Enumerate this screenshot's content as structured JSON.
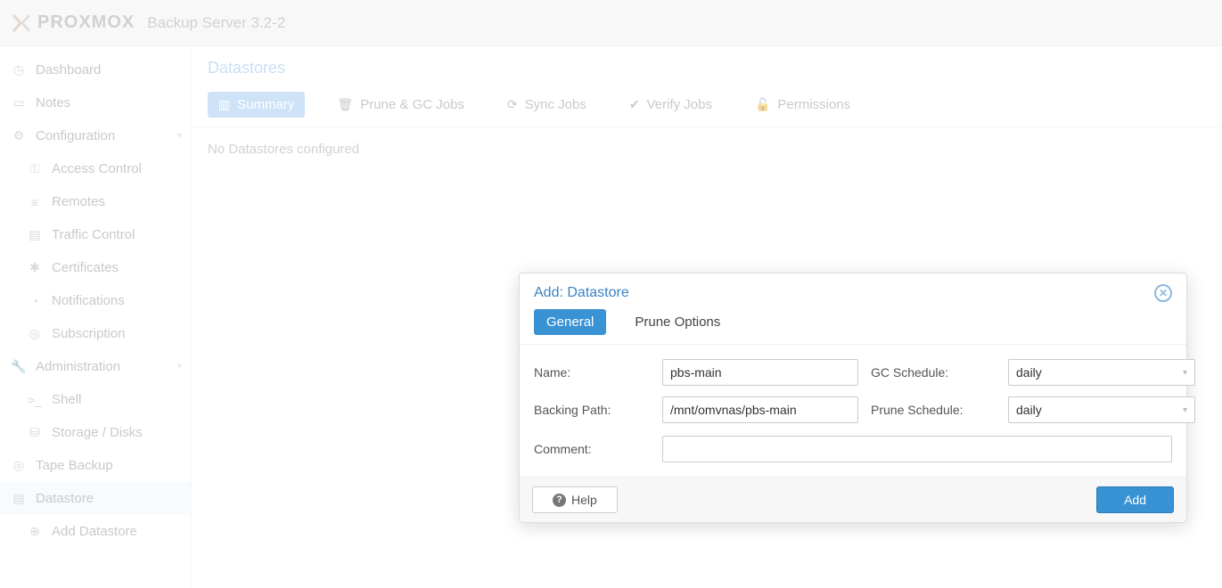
{
  "header": {
    "brand": "PROXMOX",
    "subtitle": "Backup Server 3.2-2"
  },
  "sidebar": {
    "items": [
      {
        "label": "Dashboard"
      },
      {
        "label": "Notes"
      },
      {
        "label": "Configuration"
      },
      {
        "label": "Access Control"
      },
      {
        "label": "Remotes"
      },
      {
        "label": "Traffic Control"
      },
      {
        "label": "Certificates"
      },
      {
        "label": "Notifications"
      },
      {
        "label": "Subscription"
      },
      {
        "label": "Administration"
      },
      {
        "label": "Shell"
      },
      {
        "label": "Storage / Disks"
      },
      {
        "label": "Tape Backup"
      },
      {
        "label": "Datastore"
      },
      {
        "label": "Add Datastore"
      }
    ]
  },
  "main": {
    "title": "Datastores",
    "tabs": [
      {
        "label": "Summary"
      },
      {
        "label": "Prune & GC Jobs"
      },
      {
        "label": "Sync Jobs"
      },
      {
        "label": "Verify Jobs"
      },
      {
        "label": "Permissions"
      }
    ],
    "empty_msg": "No Datastores configured"
  },
  "modal": {
    "title": "Add: Datastore",
    "tabs": {
      "general": "General",
      "prune": "Prune Options"
    },
    "labels": {
      "name": "Name:",
      "backing": "Backing Path:",
      "gc": "GC Schedule:",
      "prune": "Prune Schedule:",
      "comment": "Comment:"
    },
    "values": {
      "name": "pbs-main",
      "backing": "/mnt/omvnas/pbs-main",
      "gc": "daily",
      "prune": "daily",
      "comment": ""
    },
    "buttons": {
      "help": "Help",
      "add": "Add"
    }
  }
}
